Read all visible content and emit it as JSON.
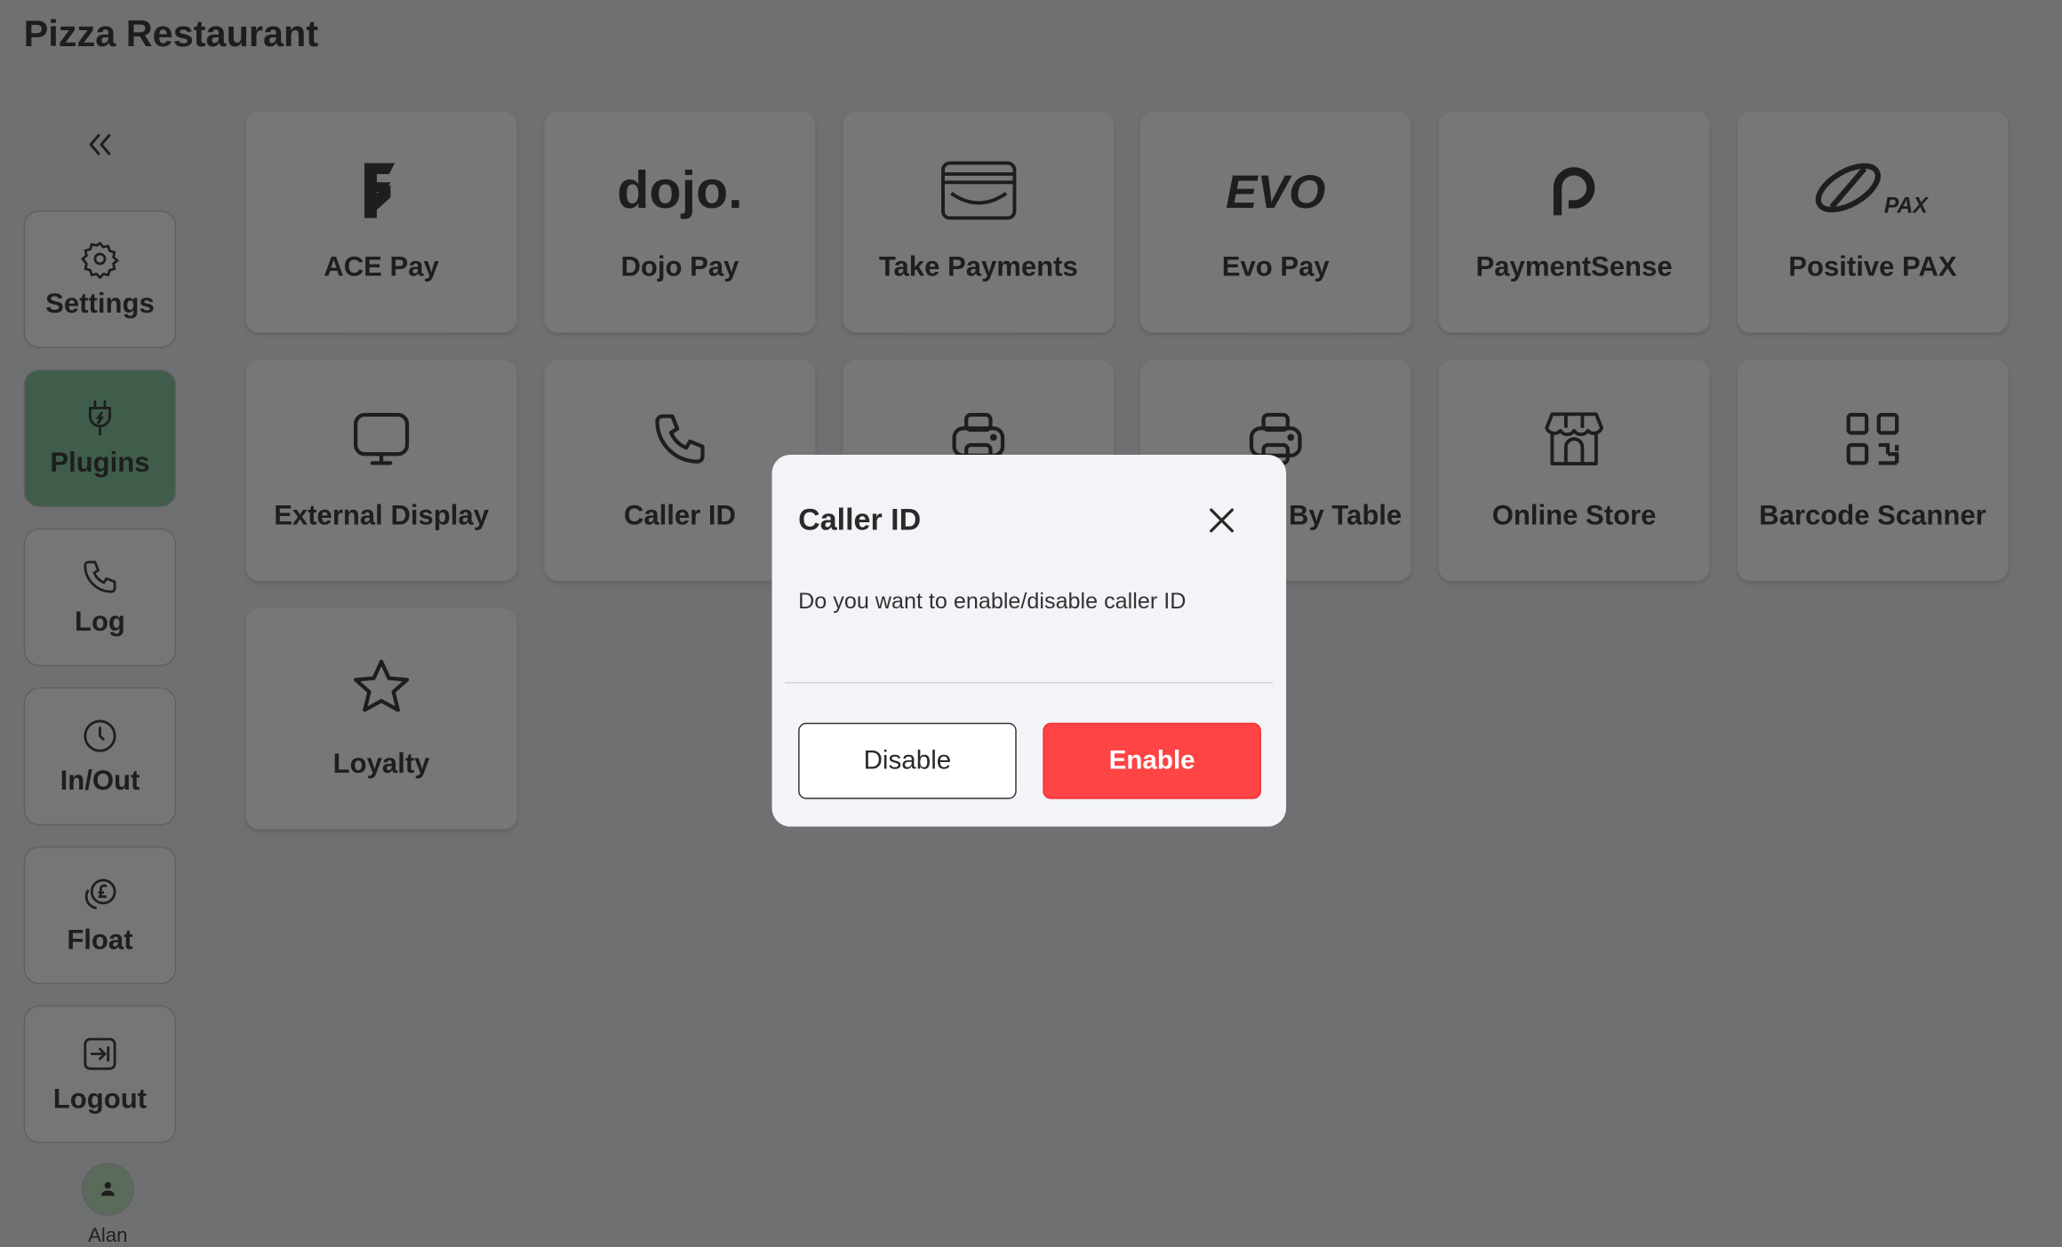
{
  "app": {
    "title": "Pizza Restaurant"
  },
  "sidebar": {
    "collapse_icon": "double-chevron-left-icon",
    "active_color": "#3f5d4a",
    "items": [
      {
        "label": "Settings",
        "icon": "gear-icon"
      },
      {
        "label": "Plugins",
        "icon": "plug-icon",
        "active": true
      },
      {
        "label": "Log",
        "icon": "phone-icon"
      },
      {
        "label": "In/Out",
        "icon": "clock-icon"
      },
      {
        "label": "Float",
        "icon": "pound-coins-icon"
      },
      {
        "label": "Logout",
        "icon": "logout-icon"
      }
    ],
    "user": {
      "name": "Alan",
      "icon": "user-icon"
    }
  },
  "plugins": [
    {
      "label": "ACE Pay",
      "icon": "ace-pay-logo"
    },
    {
      "label": "Dojo Pay",
      "icon": "dojo-logo",
      "logo_text": "dojo."
    },
    {
      "label": "Take Payments",
      "icon": "card-terminal-icon"
    },
    {
      "label": "Evo Pay",
      "icon": "evo-logo",
      "logo_text": "EVO"
    },
    {
      "label": "PaymentSense",
      "icon": "paymentsense-logo"
    },
    {
      "label": "Positive PAX",
      "icon": "pax-logo",
      "logo_text": "PAX"
    },
    {
      "label": "External Display",
      "icon": "monitor-icon"
    },
    {
      "label": "Caller ID",
      "icon": "phone-icon"
    },
    {
      "label": "",
      "icon": "printer-icon"
    },
    {
      "label": "By Table",
      "icon": "printer-icon"
    },
    {
      "label": "Online Store",
      "icon": "store-icon"
    },
    {
      "label": "Barcode Scanner",
      "icon": "qr-code-icon"
    },
    {
      "label": "Loyalty",
      "icon": "star-icon"
    }
  ],
  "modal": {
    "title": "Caller ID",
    "message": "Do you want to enable/disable caller ID",
    "disable_label": "Disable",
    "enable_label": "Enable",
    "enable_color": "#fe4444"
  }
}
